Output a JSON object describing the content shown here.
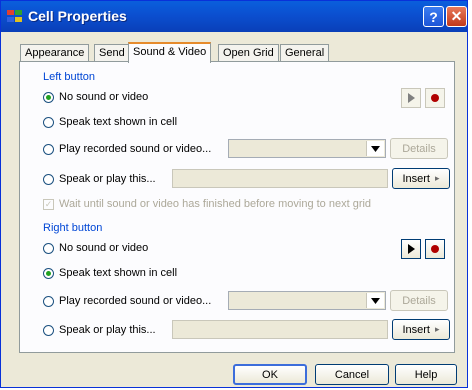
{
  "window": {
    "title": "Cell Properties",
    "help_glyph": "?",
    "close_glyph": "✕"
  },
  "tabs": [
    {
      "label": "Appearance"
    },
    {
      "label": "Send"
    },
    {
      "label": "Sound & Video"
    },
    {
      "label": "Open Grid"
    },
    {
      "label": "General"
    }
  ],
  "active_tab": "Sound & Video",
  "left": {
    "heading": "Left button",
    "options": [
      {
        "label": "No sound or video"
      },
      {
        "label": "Speak text shown in cell"
      },
      {
        "label": "Play recorded sound or video..."
      },
      {
        "label": "Speak or play this..."
      }
    ],
    "selected": "No sound or video",
    "details_label": "Details",
    "insert_label": "Insert",
    "wait_label": "Wait until sound or video has finished before moving to next grid"
  },
  "right": {
    "heading": "Right button",
    "options": [
      {
        "label": "No sound or video"
      },
      {
        "label": "Speak text shown in cell"
      },
      {
        "label": "Play recorded sound or video..."
      },
      {
        "label": "Speak or play this..."
      }
    ],
    "selected": "Speak text shown in cell",
    "details_label": "Details",
    "insert_label": "Insert"
  },
  "footer": {
    "ok": "OK",
    "cancel": "Cancel",
    "help": "Help"
  },
  "colors": {
    "title_bar": "#0b4fd0",
    "group_heading": "#0046d5",
    "record": "#b00000",
    "active_tab_accent": "#e68b2c"
  },
  "icons": {
    "play": "play-icon",
    "record": "record-icon",
    "dropdown": "chevron-down-icon",
    "insert_arrow": "arrow-right-icon"
  }
}
